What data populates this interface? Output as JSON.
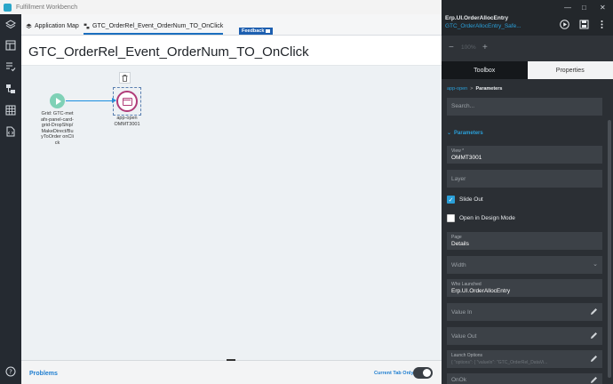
{
  "window": {
    "title": "Fulfillment Workbench"
  },
  "rail": {
    "icons": [
      "layers-icon",
      "layout-icon",
      "list-check-icon",
      "flow-icon",
      "grid-icon",
      "code-file-icon",
      "help-icon"
    ]
  },
  "tabs": [
    {
      "label": "Application Map",
      "icon": "layers-icon",
      "active": false
    },
    {
      "label": "GTC_OrderRel_Event_OrderNum_TO_OnClick",
      "icon": "flow-icon",
      "active": true
    }
  ],
  "feedback": {
    "label": "Feedback"
  },
  "page": {
    "title": "GTC_OrderRel_Event_OrderNum_TO_OnClick"
  },
  "canvas": {
    "node1_label": "Grid: GTC-metafx-panel-card-grid-DropShip/MakeDirect/BuyToOrder onClick",
    "node2_label": "app-open OMMT3001"
  },
  "bottom": {
    "problems": "Problems",
    "current_tab_only": "Current Tab Only",
    "toggle_on": true
  },
  "panel": {
    "app_name": "Erp.UI.OrderAllocEntry",
    "sub_name": "GTC_OrderAllocEntry_Safe...",
    "zoom": "100%",
    "tabs": [
      "Toolbox",
      "Properties"
    ],
    "breadcrumb": {
      "link": "app-open",
      "current": "Parameters"
    },
    "search_placeholder": "Search...",
    "section": "Parameters",
    "view": {
      "label": "View *",
      "value": "OMMT3001"
    },
    "layer": {
      "placeholder": "Layer"
    },
    "slide_out": {
      "label": "Slide Out",
      "checked": true
    },
    "design_mode": {
      "label": "Open in Design Mode",
      "checked": false
    },
    "page_field": {
      "label": "Page",
      "value": "Details"
    },
    "width": {
      "placeholder": "Width"
    },
    "who_launched": {
      "label": "Who Launched",
      "value": "Erp.UI.OrderAllocEntry"
    },
    "value_in": {
      "placeholder": "Value In"
    },
    "value_out": {
      "placeholder": "Value Out"
    },
    "launch_options": {
      "label": "Launch Options",
      "value": "{ \"options\": { \"valueIn\": \"GTC_OrderRel_DataVi..."
    },
    "on_ok": {
      "placeholder": "OnOk"
    }
  },
  "colors": {
    "accent": "#2a9fd8",
    "rail": "#252a31",
    "panel": "#2b2f34",
    "node_open": "#b03b78",
    "node_grid": "#7fd1b6"
  }
}
